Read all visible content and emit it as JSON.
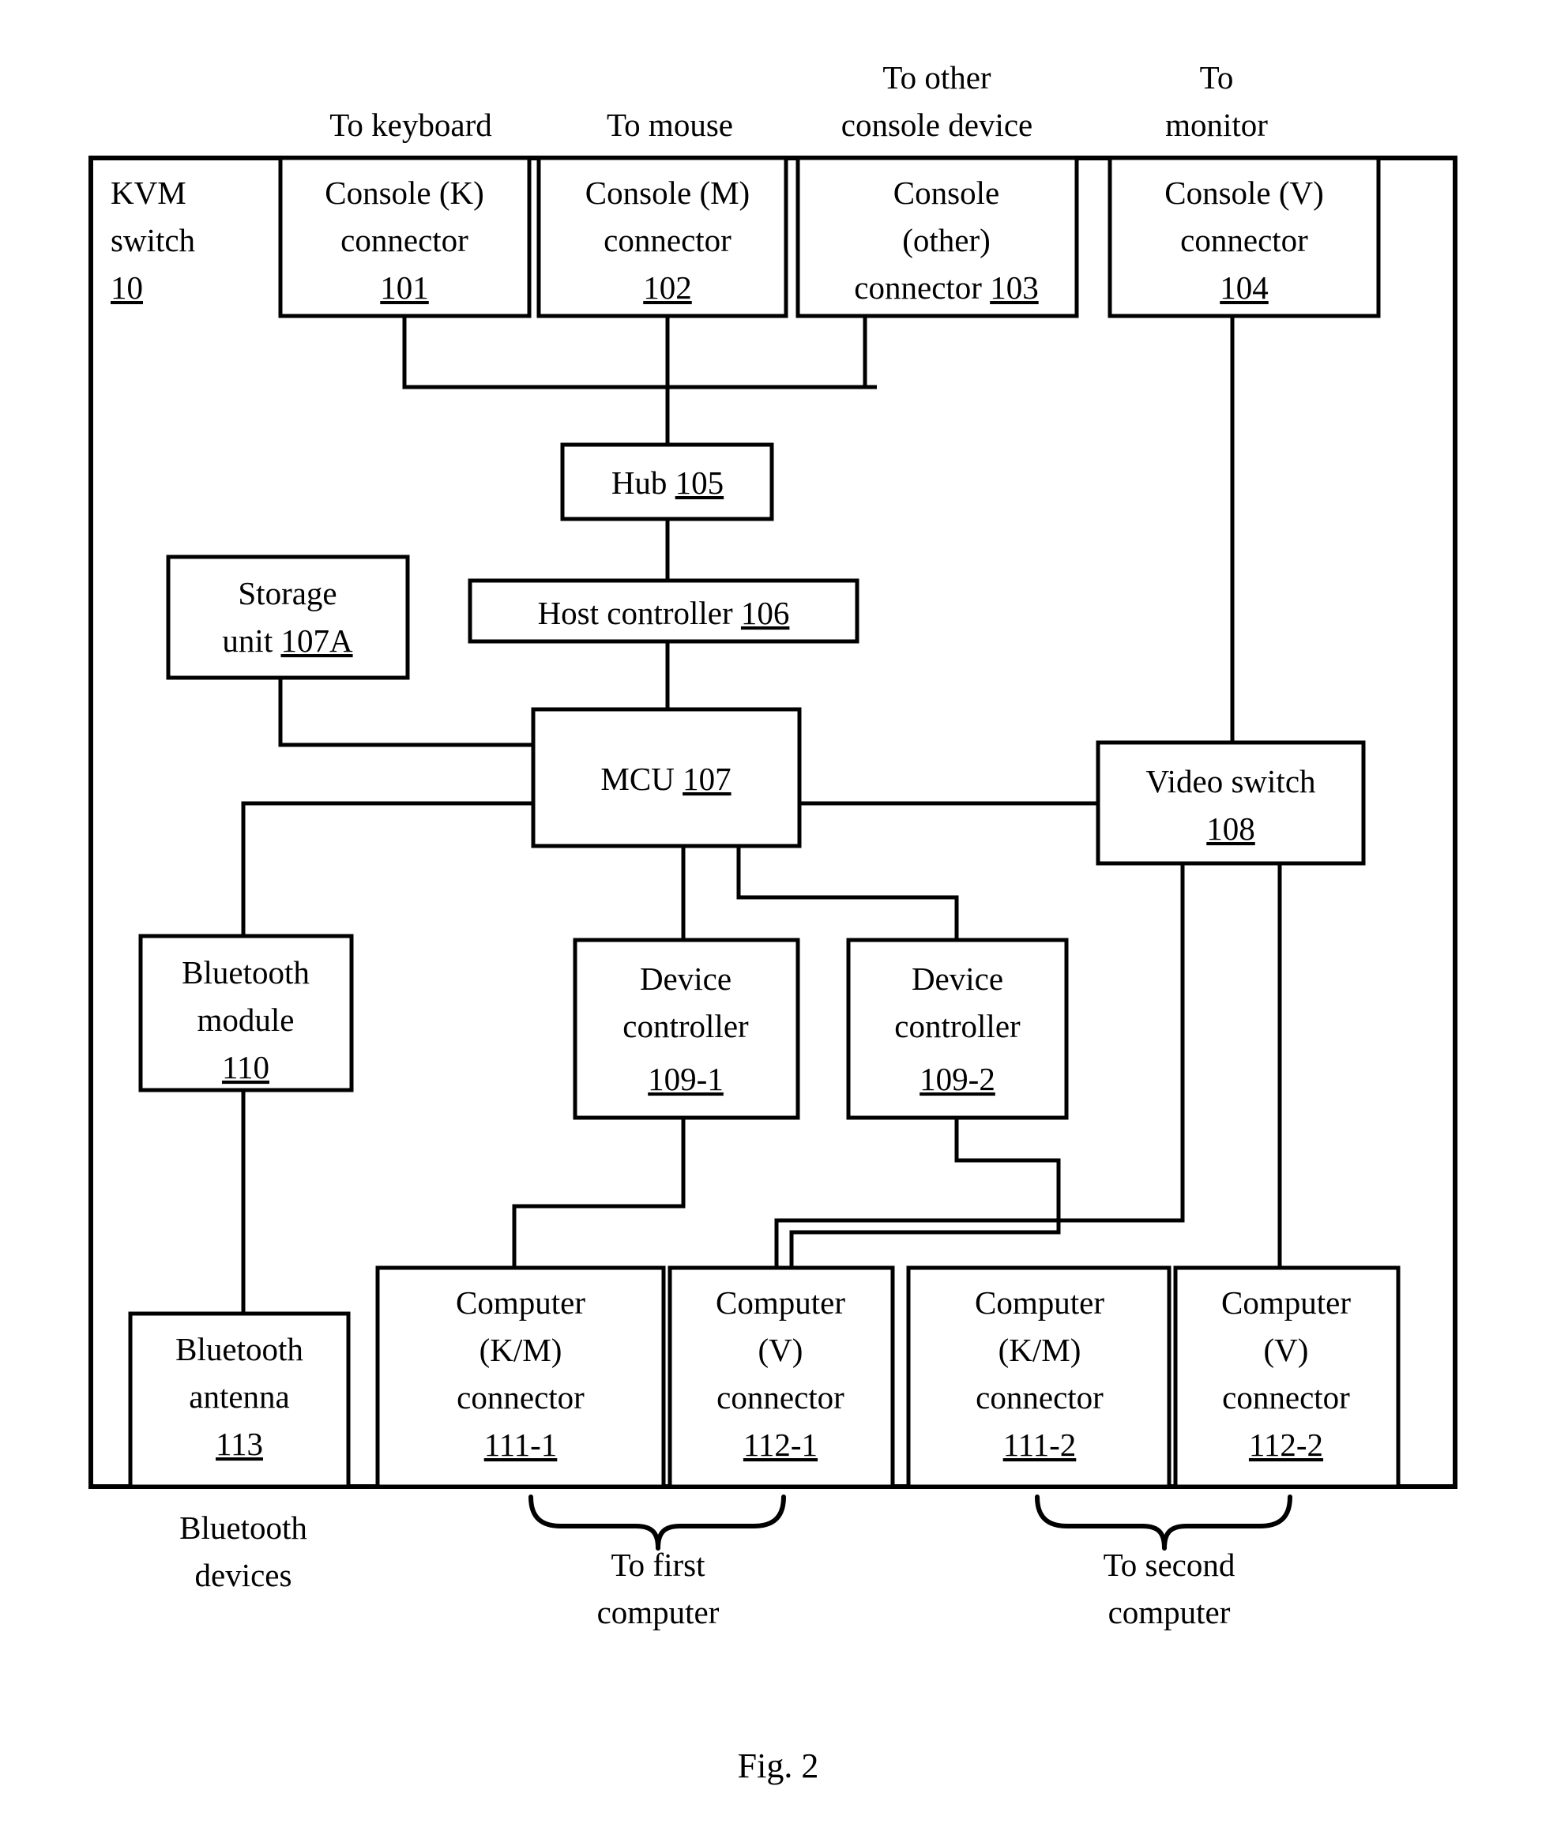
{
  "figure": {
    "caption": "Fig. 2",
    "outer_label_title": "KVM",
    "outer_label_title2": "switch",
    "outer_label_ref": "10"
  },
  "external_labels": {
    "to_keyboard": [
      "To keyboard"
    ],
    "to_mouse": [
      "To mouse"
    ],
    "to_other_console": [
      "To other",
      "console device"
    ],
    "to_monitor": [
      "To",
      "monitor"
    ],
    "bluetooth_devices": [
      "Bluetooth",
      "devices"
    ],
    "to_first_computer": [
      "To first",
      "computer"
    ],
    "to_second_computer": [
      "To second",
      "computer"
    ]
  },
  "blocks": {
    "kvm_switch": {
      "lines": [
        "KVM",
        "switch"
      ],
      "ref": "10"
    },
    "console_k": {
      "lines": [
        "Console (K)",
        "connector"
      ],
      "ref": "101"
    },
    "console_m": {
      "lines": [
        "Console (M)",
        "connector"
      ],
      "ref": "102"
    },
    "console_other": {
      "lines": [
        "Console",
        "(other)",
        "connector "
      ],
      "ref": "103"
    },
    "console_v": {
      "lines": [
        "Console (V)",
        "connector"
      ],
      "ref": "104"
    },
    "hub": {
      "lines": [
        "Hub "
      ],
      "ref": "105"
    },
    "host_controller": {
      "lines": [
        "Host controller "
      ],
      "ref": "106"
    },
    "storage_unit": {
      "lines": [
        "Storage",
        "unit "
      ],
      "ref": "107A"
    },
    "mcu": {
      "lines": [
        "MCU "
      ],
      "ref": "107"
    },
    "video_switch": {
      "lines": [
        "Video switch"
      ],
      "ref": "108"
    },
    "bluetooth_module": {
      "lines": [
        "Bluetooth",
        "module"
      ],
      "ref": "110"
    },
    "device_controller_1": {
      "lines": [
        "Device",
        "controller"
      ],
      "ref": "109-1"
    },
    "device_controller_2": {
      "lines": [
        "Device",
        "controller"
      ],
      "ref": "109-2"
    },
    "bluetooth_antenna": {
      "lines": [
        "Bluetooth",
        "antenna"
      ],
      "ref": "113"
    },
    "computer_km_1": {
      "lines": [
        "Computer",
        "(K/M)",
        "connector"
      ],
      "ref": "111-1"
    },
    "computer_v_1": {
      "lines": [
        "Computer",
        "(V)",
        "connector"
      ],
      "ref": "112-1"
    },
    "computer_km_2": {
      "lines": [
        "Computer",
        "(K/M)",
        "connector"
      ],
      "ref": "111-2"
    },
    "computer_v_2": {
      "lines": [
        "Computer",
        "(V)",
        "connector"
      ],
      "ref": "112-2"
    }
  },
  "colors": {
    "line": "#000000",
    "background": "#ffffff",
    "text": "#000000"
  }
}
